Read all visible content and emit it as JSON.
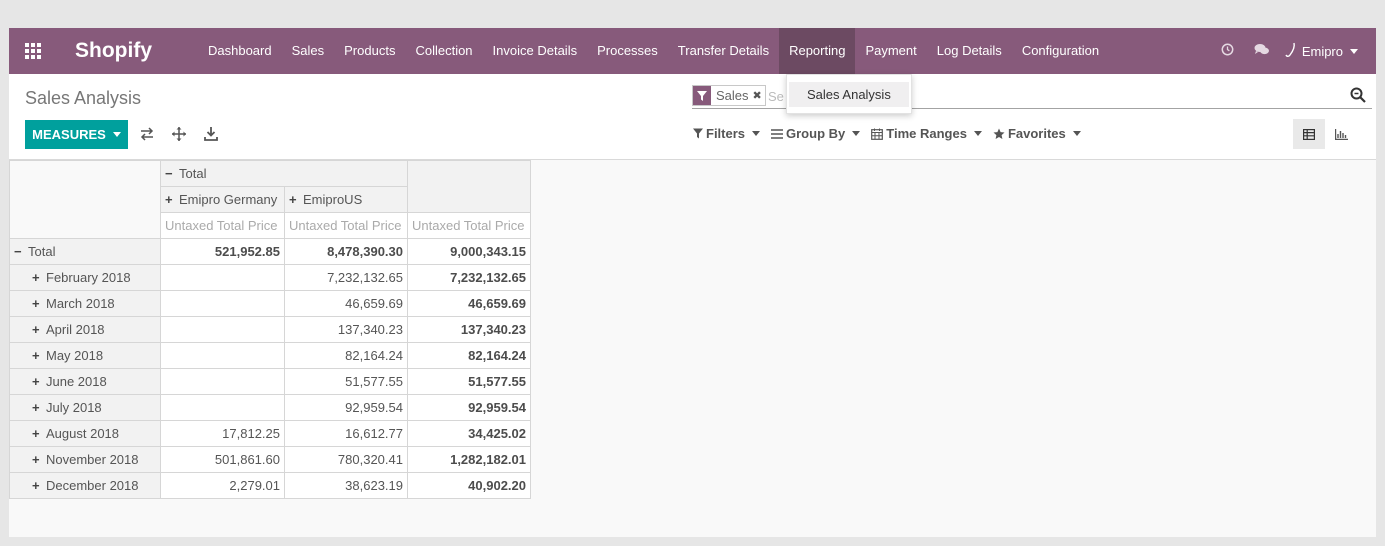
{
  "navbar": {
    "brand": "Shopify",
    "menu": [
      {
        "label": "Dashboard",
        "active": false
      },
      {
        "label": "Sales",
        "active": false
      },
      {
        "label": "Products",
        "active": false
      },
      {
        "label": "Collection",
        "active": false
      },
      {
        "label": "Invoice Details",
        "active": false
      },
      {
        "label": "Processes",
        "active": false
      },
      {
        "label": "Transfer Details",
        "active": false
      },
      {
        "label": "Reporting",
        "active": true
      },
      {
        "label": "Payment",
        "active": false
      },
      {
        "label": "Log Details",
        "active": false
      },
      {
        "label": "Configuration",
        "active": false
      }
    ],
    "user": "Emipro",
    "colors": {
      "bar": "#875a7b",
      "active": "#6c4a62"
    }
  },
  "dropdown": {
    "items": [
      "Sales Analysis"
    ]
  },
  "control_panel": {
    "title": "Sales Analysis",
    "measures_label": "MEASURES",
    "measures_color": "#00a09d",
    "search": {
      "facet": "Sales",
      "placeholder": "Se"
    },
    "filters": [
      "Filters",
      "Group By",
      "Time Ranges",
      "Favorites"
    ]
  },
  "pivot": {
    "total_header": "Total",
    "columns": [
      "Emipro Germany",
      "EmiproUS"
    ],
    "measure": "Untaxed Total Price",
    "total_row": {
      "label": "Total",
      "values": [
        "521,952.85",
        "8,478,390.30",
        "9,000,343.15"
      ]
    },
    "rows": [
      {
        "label": "February 2018",
        "values": [
          "",
          "7,232,132.65",
          "7,232,132.65"
        ]
      },
      {
        "label": "March 2018",
        "values": [
          "",
          "46,659.69",
          "46,659.69"
        ]
      },
      {
        "label": "April 2018",
        "values": [
          "",
          "137,340.23",
          "137,340.23"
        ]
      },
      {
        "label": "May 2018",
        "values": [
          "",
          "82,164.24",
          "82,164.24"
        ]
      },
      {
        "label": "June 2018",
        "values": [
          "",
          "51,577.55",
          "51,577.55"
        ]
      },
      {
        "label": "July 2018",
        "values": [
          "",
          "92,959.54",
          "92,959.54"
        ]
      },
      {
        "label": "August 2018",
        "values": [
          "17,812.25",
          "16,612.77",
          "34,425.02"
        ]
      },
      {
        "label": "November 2018",
        "values": [
          "501,861.60",
          "780,320.41",
          "1,282,182.01"
        ]
      },
      {
        "label": "December 2018",
        "values": [
          "2,279.01",
          "38,623.19",
          "40,902.20"
        ]
      }
    ]
  }
}
